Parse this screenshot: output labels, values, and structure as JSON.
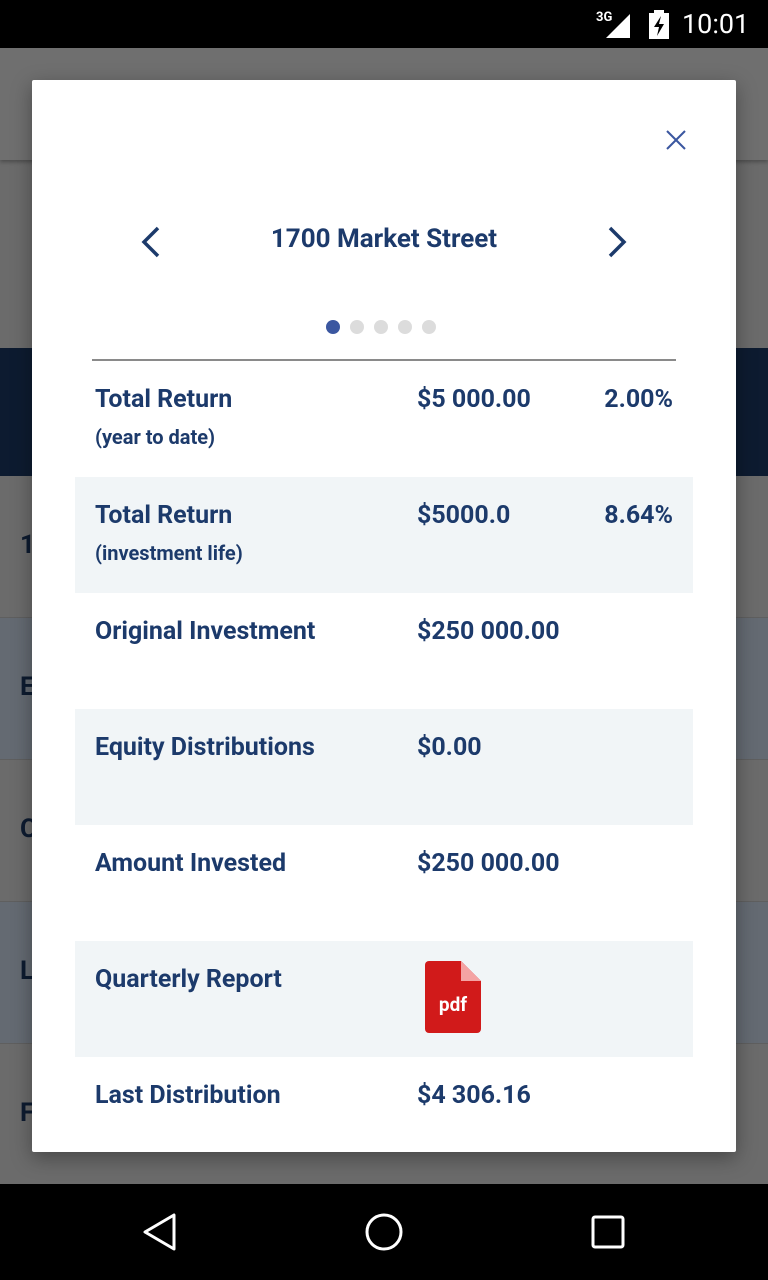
{
  "status_bar": {
    "network": "3G",
    "time": "10:01"
  },
  "background": {
    "row_letters": [
      "1",
      "E",
      "C",
      "L",
      "F"
    ]
  },
  "modal": {
    "title": "1700 Market Street",
    "close_icon": "close-icon",
    "prev_icon": "chevron-left-icon",
    "next_icon": "chevron-right-icon",
    "pager": {
      "total": 5,
      "active": 1
    },
    "rows": [
      {
        "label": "Total Return",
        "sub": "(year to date)",
        "value": "$5 000.00",
        "pct": "2.00%"
      },
      {
        "label": "Total Return",
        "sub": "(investment life)",
        "value": "$5000.0",
        "pct": "8.64%"
      },
      {
        "label": "Original Investment",
        "value": "$250 000.00"
      },
      {
        "label": "Equity Distributions",
        "value": "$0.00"
      },
      {
        "label": "Amount Invested",
        "value": "$250 000.00"
      },
      {
        "label": "Quarterly Report",
        "file_label": "pdf",
        "file_icon": "pdf-file-icon"
      },
      {
        "label": "Last Distribution",
        "value": "$4 306.16"
      }
    ]
  },
  "colors": {
    "accent": "#1c3a6b",
    "active_dot": "#3b57a0",
    "pdf_red": "#d11a1a",
    "shade": "#f1f5f7"
  },
  "nav_bar": {
    "back_icon": "back-triangle-icon",
    "home_icon": "home-circle-icon",
    "recents_icon": "recents-square-icon"
  }
}
